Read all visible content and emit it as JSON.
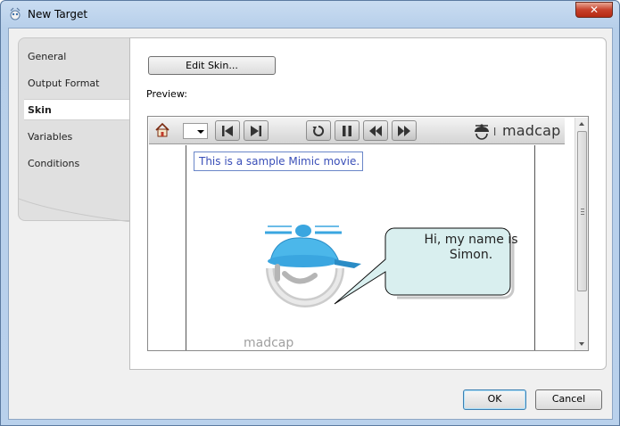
{
  "window": {
    "title": "New Target",
    "close_symbol": "✕"
  },
  "nav": {
    "items": [
      {
        "label": "General"
      },
      {
        "label": "Output Format"
      },
      {
        "label": "Skin",
        "selected": true
      },
      {
        "label": "Variables"
      },
      {
        "label": "Conditions"
      }
    ]
  },
  "content": {
    "edit_skin_label": "Edit Skin...",
    "preview_label": "Preview:"
  },
  "preview": {
    "toolbar": {
      "logo_text": "madcap",
      "icons": [
        "home-icon",
        "go-to-start-icon",
        "go-to-end-icon",
        "replay-icon",
        "pause-icon",
        "rewind-icon",
        "fast-forward-icon"
      ]
    },
    "caption": "This is a sample Mimic movie.",
    "bubble_line1": "Hi, my name is",
    "bubble_line2": "Simon.",
    "watermark": "madcap"
  },
  "footer": {
    "ok_label": "OK",
    "cancel_label": "Cancel"
  },
  "colors": {
    "title_gradient": "#b9d1ec",
    "caption_border": "#6a86c8",
    "caption_text": "#3a4fb8",
    "bubble_fill": "#d7efef",
    "simon_blue": "#3aa6e0",
    "close_red": "#c7412b"
  }
}
